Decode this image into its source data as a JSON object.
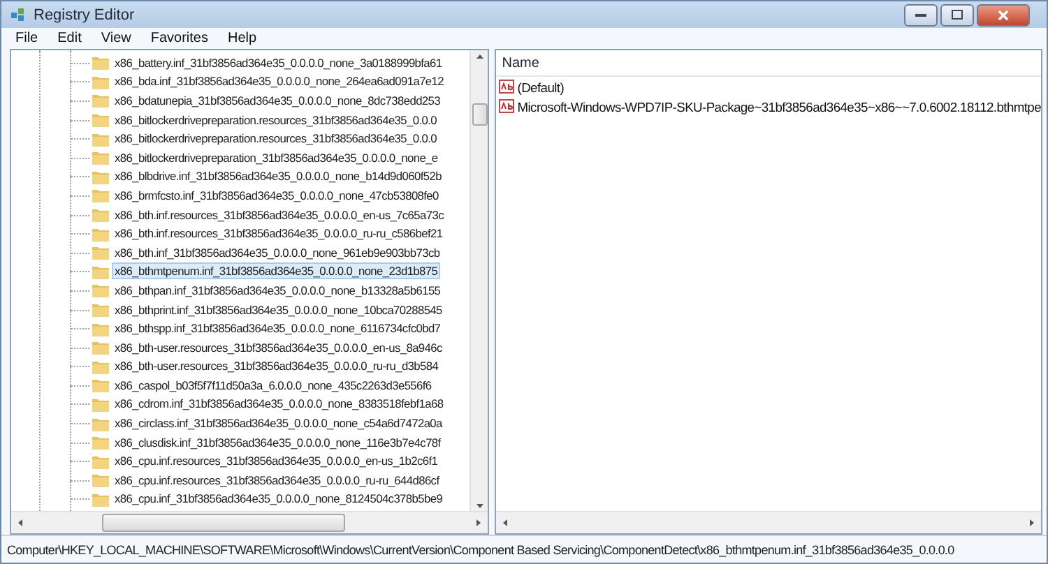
{
  "window": {
    "title": "Registry Editor"
  },
  "menu": [
    "File",
    "Edit",
    "View",
    "Favorites",
    "Help"
  ],
  "tree": {
    "items": [
      {
        "label": "x86_battery.inf_31bf3856ad364e35_0.0.0.0_none_3a0188999bfa61",
        "selected": false
      },
      {
        "label": "x86_bda.inf_31bf3856ad364e35_0.0.0.0_none_264ea6ad091a7e12",
        "selected": false
      },
      {
        "label": "x86_bdatunepia_31bf3856ad364e35_0.0.0.0_none_8dc738edd253",
        "selected": false
      },
      {
        "label": "x86_bitlockerdrivepreparation.resources_31bf3856ad364e35_0.0.0",
        "selected": false
      },
      {
        "label": "x86_bitlockerdrivepreparation.resources_31bf3856ad364e35_0.0.0",
        "selected": false
      },
      {
        "label": "x86_bitlockerdrivepreparation_31bf3856ad364e35_0.0.0.0_none_e",
        "selected": false
      },
      {
        "label": "x86_blbdrive.inf_31bf3856ad364e35_0.0.0.0_none_b14d9d060f52b",
        "selected": false
      },
      {
        "label": "x86_brmfcsto.inf_31bf3856ad364e35_0.0.0.0_none_47cb53808fe0",
        "selected": false
      },
      {
        "label": "x86_bth.inf.resources_31bf3856ad364e35_0.0.0.0_en-us_7c65a73c",
        "selected": false
      },
      {
        "label": "x86_bth.inf.resources_31bf3856ad364e35_0.0.0.0_ru-ru_c586bef21",
        "selected": false
      },
      {
        "label": "x86_bth.inf_31bf3856ad364e35_0.0.0.0_none_961eb9e903bb73cb",
        "selected": false
      },
      {
        "label": "x86_bthmtpenum.inf_31bf3856ad364e35_0.0.0.0_none_23d1b875",
        "selected": true
      },
      {
        "label": "x86_bthpan.inf_31bf3856ad364e35_0.0.0.0_none_b13328a5b6155",
        "selected": false
      },
      {
        "label": "x86_bthprint.inf_31bf3856ad364e35_0.0.0.0_none_10bca70288545",
        "selected": false
      },
      {
        "label": "x86_bthspp.inf_31bf3856ad364e35_0.0.0.0_none_6116734cfc0bd7",
        "selected": false
      },
      {
        "label": "x86_bth-user.resources_31bf3856ad364e35_0.0.0.0_en-us_8a946c",
        "selected": false
      },
      {
        "label": "x86_bth-user.resources_31bf3856ad364e35_0.0.0.0_ru-ru_d3b584",
        "selected": false
      },
      {
        "label": "x86_caspol_b03f5f7f11d50a3a_6.0.0.0_none_435c2263d3e556f6",
        "selected": false
      },
      {
        "label": "x86_cdrom.inf_31bf3856ad364e35_0.0.0.0_none_8383518febf1a68",
        "selected": false
      },
      {
        "label": "x86_circlass.inf_31bf3856ad364e35_0.0.0.0_none_c54a6d7472a0a",
        "selected": false
      },
      {
        "label": "x86_clusdisk.inf_31bf3856ad364e35_0.0.0.0_none_116e3b7e4c78f",
        "selected": false
      },
      {
        "label": "x86_cpu.inf.resources_31bf3856ad364e35_0.0.0.0_en-us_1b2c6f1",
        "selected": false
      },
      {
        "label": "x86_cpu.inf.resources_31bf3856ad364e35_0.0.0.0_ru-ru_644d86cf",
        "selected": false
      },
      {
        "label": "x86_cpu.inf_31bf3856ad364e35_0.0.0.0_none_8124504c378b5be9",
        "selected": false
      }
    ]
  },
  "values": {
    "columns": [
      "Name"
    ],
    "rows": [
      {
        "name": "(Default)"
      },
      {
        "name": "Microsoft-Windows-WPD7IP-SKU-Package~31bf3856ad364e35~x86~~7.0.6002.18112.bthmtpe"
      }
    ]
  },
  "status_bar": "Computer\\HKEY_LOCAL_MACHINE\\SOFTWARE\\Microsoft\\Windows\\CurrentVersion\\Component Based Servicing\\ComponentDetect\\x86_bthmtpenum.inf_31bf3856ad364e35_0.0.0.0"
}
